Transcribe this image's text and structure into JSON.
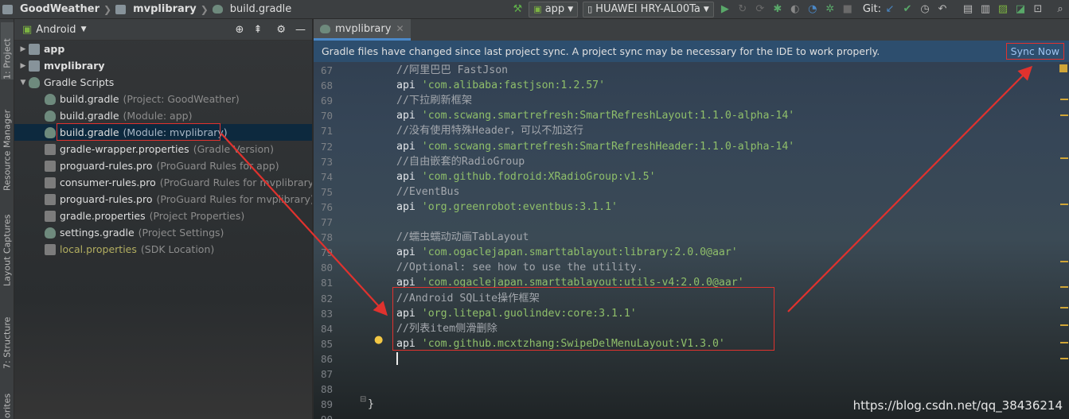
{
  "toolbar": {
    "project": "GoodWeather",
    "module": "mvplibrary",
    "file": "build.gradle",
    "run_config": "app",
    "device": "HUAWEI HRY-AL00Ta",
    "git_label": "Git:"
  },
  "stripe": {
    "project_tab": "1: Project",
    "resource_tab": "Resource Manager",
    "captures_tab": "Layout Captures",
    "structure_tab": "7: Structure",
    "favorites_tab": "orites"
  },
  "project": {
    "view_label": "Android",
    "items": [
      {
        "name": "app",
        "hint": ""
      },
      {
        "name": "mvplibrary",
        "hint": ""
      },
      {
        "name": "Gradle Scripts",
        "hint": ""
      },
      {
        "name": "build.gradle",
        "hint": "(Project: GoodWeather)"
      },
      {
        "name": "build.gradle",
        "hint": "(Module: app)"
      },
      {
        "name": "build.gradle",
        "hint": "(Module: mvplibrary)"
      },
      {
        "name": "gradle-wrapper.properties",
        "hint": "(Gradle Version)"
      },
      {
        "name": "proguard-rules.pro",
        "hint": "(ProGuard Rules for app)"
      },
      {
        "name": "consumer-rules.pro",
        "hint": "(ProGuard Rules for mvplibrary)"
      },
      {
        "name": "proguard-rules.pro",
        "hint": "(ProGuard Rules for mvplibrary)"
      },
      {
        "name": "gradle.properties",
        "hint": "(Project Properties)"
      },
      {
        "name": "settings.gradle",
        "hint": "(Project Settings)"
      },
      {
        "name": "local.properties",
        "hint": "(SDK Location)"
      }
    ]
  },
  "editor": {
    "tab_label": "mvplibrary",
    "banner_text": "Gradle files have changed since last project sync. A project sync may be necessary for the IDE to work properly.",
    "sync_label": "Sync Now",
    "lines": [
      {
        "n": "67",
        "cmt": "//阿里巴巴 FastJson",
        "kw": "",
        "str": ""
      },
      {
        "n": "68",
        "cmt": "",
        "kw": "api ",
        "str": "'com.alibaba:fastjson:1.2.57'"
      },
      {
        "n": "69",
        "cmt": "//下拉刷新框架",
        "kw": "",
        "str": ""
      },
      {
        "n": "70",
        "cmt": "",
        "kw": "api ",
        "str": "'com.scwang.smartrefresh:SmartRefreshLayout:1.1.0-alpha-14'"
      },
      {
        "n": "71",
        "cmt": "//没有使用特殊Header，可以不加这行",
        "kw": "",
        "str": ""
      },
      {
        "n": "72",
        "cmt": "",
        "kw": "api ",
        "str": "'com.scwang.smartrefresh:SmartRefreshHeader:1.1.0-alpha-14'"
      },
      {
        "n": "73",
        "cmt": "//自由嵌套的RadioGroup",
        "kw": "",
        "str": ""
      },
      {
        "n": "74",
        "cmt": "",
        "kw": "api ",
        "str": "'com.github.fodroid:XRadioGroup:v1.5'"
      },
      {
        "n": "75",
        "cmt": "//EventBus",
        "kw": "",
        "str": ""
      },
      {
        "n": "76",
        "cmt": "",
        "kw": "api ",
        "str": "'org.greenrobot:eventbus:3.1.1'"
      },
      {
        "n": "77",
        "cmt": "",
        "kw": "",
        "str": ""
      },
      {
        "n": "78",
        "cmt": "//蠕虫蠕动动画TabLayout",
        "kw": "",
        "str": ""
      },
      {
        "n": "79",
        "cmt": "",
        "kw": "api ",
        "str": "'com.ogaclejapan.smarttablayout:library:2.0.0@aar'"
      },
      {
        "n": "80",
        "cmt": "//Optional: see how to use the utility.",
        "kw": "",
        "str": ""
      },
      {
        "n": "81",
        "cmt": "",
        "kw": "api ",
        "str": "'com.ogaclejapan.smarttablayout:utils-v4:2.0.0@aar'"
      },
      {
        "n": "82",
        "cmt": "//Android SQLite操作框架",
        "kw": "",
        "str": ""
      },
      {
        "n": "83",
        "cmt": "",
        "kw": "api ",
        "str": "'org.litepal.guolindev:core:3.1.1'"
      },
      {
        "n": "84",
        "cmt": "//列表item侧滑删除",
        "kw": "",
        "str": ""
      },
      {
        "n": "85",
        "cmt": "",
        "kw": "api ",
        "str": "'com.github.mcxtzhang:SwipeDelMenuLayout:V1.3.0'"
      },
      {
        "n": "86",
        "cmt": "",
        "kw": "",
        "str": ""
      },
      {
        "n": "87",
        "cmt": "",
        "kw": "",
        "str": ""
      },
      {
        "n": "88",
        "cmt": "",
        "kw": "",
        "str": ""
      },
      {
        "n": "89",
        "cmt": "",
        "kw": "",
        "str": ""
      },
      {
        "n": "90",
        "cmt": "",
        "kw": "",
        "str": ""
      }
    ],
    "closing_brace": "}"
  },
  "watermark": "https://blog.csdn.net/qq_38436214",
  "colors": {
    "highlight_box": "#e0322e",
    "banner": "#2d4e6e",
    "string": "#8fbf6a"
  }
}
